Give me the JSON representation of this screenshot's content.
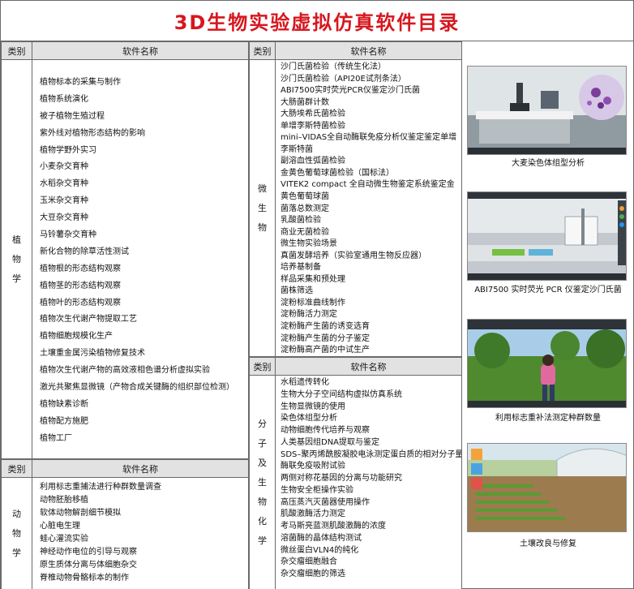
{
  "title": "3D生物实验虚拟仿真软件目录",
  "header": {
    "category": "类别",
    "software": "软件名称"
  },
  "plants": {
    "category": [
      "植",
      "物",
      "学"
    ],
    "items": [
      "植物标本的采集与制作",
      "植物系统演化",
      "被子植物生殖过程",
      "紫外线对植物形态结构的影响",
      "植物学野外实习",
      "小麦杂交育种",
      "水稻杂交育种",
      "玉米杂交育种",
      "大豆杂交育种",
      "马铃薯杂交育种",
      "新化合物的除草活性测试",
      "植物根的形态结构观察",
      "植物茎的形态结构观察",
      "植物叶的形态结构观察",
      "植物次生代谢产物提取工艺",
      "植物细胞规模化生产",
      "土壤重金属污染植物修复技术",
      "植物次生代谢产物的高效液相色谱分析虚拟实验",
      "激光共聚焦显微镜（产物合成关键酶的组织部位检测）",
      "植物缺素诊断",
      "植物配方施肥",
      "植物工厂"
    ]
  },
  "animals": {
    "category": [
      "动",
      "物",
      "学"
    ],
    "items": [
      "利用标志重捕法进行种群数量调查",
      "动物胚胎移植",
      "软体动物解剖细节模拟",
      "心脏电生理",
      "蛙心灌流实验",
      "神经动作电位的引导与观察",
      "原生质体分离与体细胞杂交",
      "脊椎动物骨骼标本的制作"
    ]
  },
  "micro": {
    "category": [
      "微",
      "生",
      "物"
    ],
    "items": [
      "沙门氏菌检验（传统生化法）",
      "沙门氏菌检验（API20E试剂条法）",
      "ABI7500实时荧光PCR仪鉴定沙门氏菌",
      "大肠菌群计数",
      "大肠埃希氏菌检验",
      "单增李斯特菌检验",
      "mini–VIDAS全自动酶联免疫分析仪鉴定鉴定单增",
      "李斯特菌",
      "副溶血性弧菌检验",
      "金黄色葡萄球菌检验（国标法）",
      "VITEK2 compact 全自动微生物鉴定系统鉴定金",
      "黄色葡萄球菌",
      "菌落总数测定",
      "乳酸菌检验",
      "商业无菌检验",
      "微生物实验场景",
      "真菌发酵培养（实验室通用生物反应器）",
      "培养基制备",
      "样品采集和预处理",
      "菌株筛选",
      "淀粉标准曲线制作",
      "淀粉酶活力测定",
      "淀粉酶产生菌的诱变选育",
      "淀粉酶产生菌的分子鉴定",
      "淀粉酶高产菌的中试生产"
    ]
  },
  "molecular": {
    "category": [
      "分",
      "子",
      "及",
      "生",
      "物",
      "化",
      "学"
    ],
    "items": [
      "水稻遗传转化",
      "生物大分子空间结构虚拟仿真系统",
      "生物显微镜的使用",
      "染色体组型分析",
      "动物细胞传代培养与观察",
      "人类基因组DNA提取与鉴定",
      "SDS–聚丙烯酰胺凝胶电泳测定蛋白质的相对分子量",
      "酶联免疫吸附试验",
      "两侧对称花基因的分离与功能研究",
      "生物安全柜操作实验",
      "高压蒸汽灭菌器使用操作",
      "肌酸激酶活力测定",
      "考马斯亮蓝测肌酸激酶的浓度",
      "溶菌酶的晶体结构测试",
      "微丝蛋白VLN4的纯化",
      "杂交瘤细胞融合",
      "杂交瘤细胞的筛选"
    ]
  },
  "screenshots": [
    {
      "caption": "大麦染色体组型分析",
      "icon": "lab-microscope-scene"
    },
    {
      "caption": "ABI7500 实时荧光 PCR 仪鉴定沙门氏菌",
      "icon": "lab-bench-scene"
    },
    {
      "caption": "利用标志重补法测定种群数量",
      "icon": "field-student-scene"
    },
    {
      "caption": "土壤改良与修复",
      "icon": "greenhouse-field-scene"
    }
  ]
}
